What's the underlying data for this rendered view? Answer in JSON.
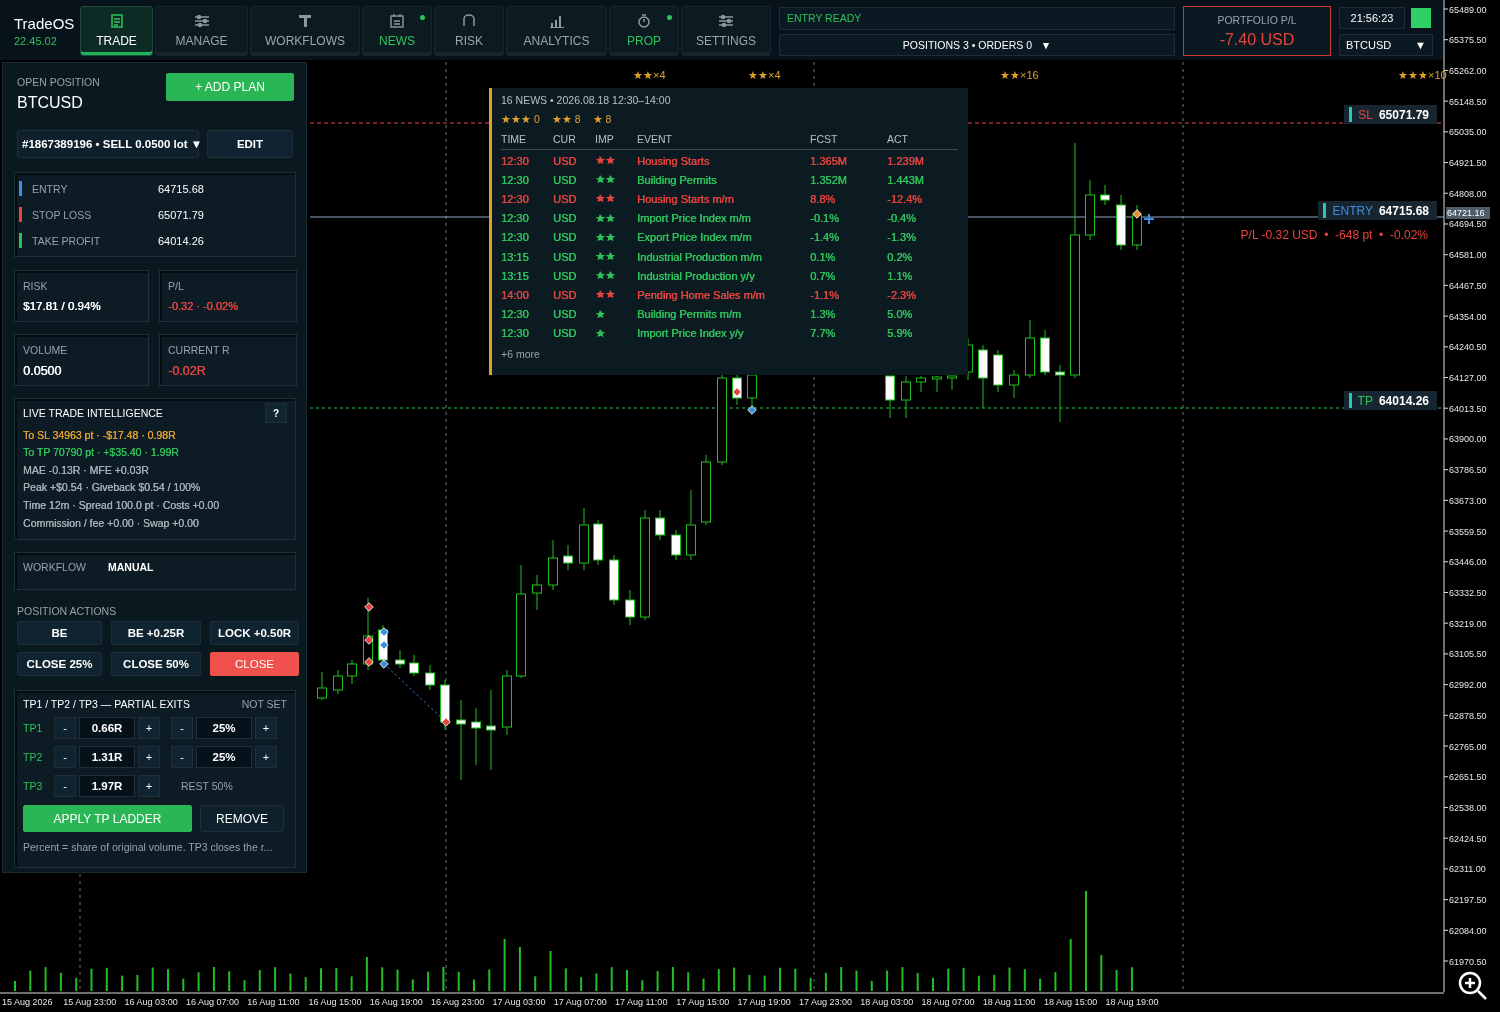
{
  "app": {
    "name": "TradeOS",
    "version": "22.45.02"
  },
  "tabs": [
    {
      "label": "TRADE",
      "selected": true,
      "alert": false
    },
    {
      "label": "MANAGE",
      "selected": false,
      "alert": false
    },
    {
      "label": "WORKFLOWS",
      "selected": false,
      "alert": false
    },
    {
      "label": "NEWS",
      "selected": false,
      "alert": true
    },
    {
      "label": "RISK",
      "selected": false,
      "alert": false
    },
    {
      "label": "ANALYTICS",
      "selected": false,
      "alert": false
    },
    {
      "label": "PROP",
      "selected": false,
      "alert": true
    },
    {
      "label": "SETTINGS",
      "selected": false,
      "alert": false
    }
  ],
  "status": {
    "message": "ENTRY READY",
    "summary": "POSITIONS 3 • ORDERS 0",
    "caret": "▼"
  },
  "portfolio": {
    "label": "PORTFOLIO P/L",
    "value": "-7.40 USD"
  },
  "clock": {
    "time": "21:56:23",
    "live": true,
    "symbol": "BTCUSD",
    "caret": "▼"
  },
  "position_panel": {
    "title": "OPEN POSITION",
    "symbol": "BTCUSD",
    "add_button": "+ ADD PLAN",
    "ticket": "#1867389196 • SELL 0.0500 lot ▼",
    "edit_button": "EDIT",
    "levels": [
      {
        "label": "ENTRY",
        "value": "64715.68",
        "color": "#3b8fe0"
      },
      {
        "label": "STOP LOSS",
        "value": "65071.79",
        "color": "#e5443f"
      },
      {
        "label": "TAKE PROFIT",
        "value": "64014.26",
        "color": "#2fc25b"
      }
    ],
    "metrics": [
      {
        "label": "RISK",
        "value": "$17.81 / 0.94%",
        "color": "#ffffff"
      },
      {
        "label": "P/L",
        "value": "-0.32 · -0.02%",
        "color": "#e5443f"
      },
      {
        "label": "VOLUME",
        "value": "0.0500",
        "color": "#ffffff"
      },
      {
        "label": "CURRENT R",
        "value": "-0.02R",
        "color": "#e5443f"
      }
    ],
    "intelligence": {
      "title": "LIVE TRADE INTELLIGENCE",
      "help": "?",
      "lines": [
        {
          "text": "To SL  34963 pt · -$17.48 · 0.98R",
          "color": "#e0a02c"
        },
        {
          "text": "To TP  70790 pt · +$35.40 · 1.99R",
          "color": "#2fc25b"
        },
        {
          "text": "MAE -0.13R · MFE +0.03R",
          "color": "#a3afb5"
        },
        {
          "text": "Peak +$0.54 · Giveback $0.54 / 100%",
          "color": "#a3afb5"
        },
        {
          "text": "Time 12m · Spread 100.0 pt · Costs +0.00",
          "color": "#a3afb5"
        },
        {
          "text": "Commission / fee +0.00 · Swap +0.00",
          "color": "#a3afb5"
        }
      ]
    },
    "workflow": {
      "label": "WORKFLOW",
      "value": "MANUAL"
    },
    "actions_title": "POSITION ACTIONS",
    "actions": [
      {
        "label": "BE",
        "kind": "normal"
      },
      {
        "label": "BE +0.25R",
        "kind": "normal"
      },
      {
        "label": "LOCK +0.50R",
        "kind": "normal"
      },
      {
        "label": "CLOSE 25%",
        "kind": "normal"
      },
      {
        "label": "CLOSE 50%",
        "kind": "normal"
      },
      {
        "label": "CLOSE",
        "kind": "danger"
      }
    ],
    "tp_ladder": {
      "title": "TP1 / TP2 / TP3 — PARTIAL EXITS",
      "state": "NOT SET",
      "rows": [
        {
          "label": "TP1",
          "minus": "-",
          "value": "0.66R",
          "plus": "+",
          "kind": "stepper",
          "p_minus": "-",
          "percent": "25%",
          "p_plus": "+"
        },
        {
          "label": "TP2",
          "minus": "-",
          "value": "1.31R",
          "plus": "+",
          "kind": "stepper",
          "p_minus": "-",
          "percent": "25%",
          "p_plus": "+"
        },
        {
          "label": "TP3",
          "minus": "-",
          "value": "1.97R",
          "plus": "+",
          "kind": "rest",
          "rest": "REST 50%"
        }
      ],
      "apply_button": "APPLY TP LADDER",
      "remove_button": "REMOVE",
      "note": "Percent = share of original volume. TP3 closes the r..."
    }
  },
  "chart": {
    "news_markers": [
      "★★×4",
      "★★×4",
      "★★×16",
      "★★★×10"
    ],
    "levels": [
      {
        "kind": "sl",
        "label": "SL",
        "value": "65071.79"
      },
      {
        "kind": "entry",
        "label": "ENTRY",
        "value": "64715.68"
      },
      {
        "kind": "tp",
        "label": "TP",
        "value": "64014.26"
      }
    ],
    "pl_line": "P/L -0.32 USD  •  -648 pt  •  -0.02%",
    "price_tag": "64721.16",
    "price_labels": [
      "65489.00",
      "65375.50",
      "65262.00",
      "65148.50",
      "65035.00",
      "64921.50",
      "64808.00",
      "64694.50",
      "64581.00",
      "64467.50",
      "64354.00",
      "64240.50",
      "64127.00",
      "64013.50",
      "63900.00",
      "63786.50",
      "63673.00",
      "63559.50",
      "63446.00",
      "63332.50",
      "63219.00",
      "63105.50",
      "62992.00",
      "62878.50",
      "62765.00",
      "62651.50",
      "62538.00",
      "62424.50",
      "62311.00",
      "62197.50",
      "62084.00",
      "61970.50"
    ],
    "time_labels": [
      "15 Aug 2026",
      "15 Aug 23:00",
      "16 Aug 03:00",
      "16 Aug 07:00",
      "16 Aug 11:00",
      "16 Aug 15:00",
      "16 Aug 19:00",
      "16 Aug 23:00",
      "17 Aug 03:00",
      "17 Aug 07:00",
      "17 Aug 11:00",
      "17 Aug 15:00",
      "17 Aug 19:00",
      "17 Aug 23:00",
      "18 Aug 03:00",
      "18 Aug 07:00",
      "18 Aug 11:00",
      "18 Aug 15:00",
      "18 Aug 19:00"
    ]
  },
  "news_popup": {
    "header": "16 NEWS • 2026.08.18 12:30–14:00",
    "counts": [
      "★★★ 0",
      "★★ 8",
      "★ 8"
    ],
    "columns": [
      "TIME",
      "CUR",
      "IMP",
      "EVENT",
      "FCST",
      "ACT"
    ],
    "rows": [
      {
        "time": "12:30",
        "cur": "USD",
        "imp": "★★",
        "event": "Housing Starts",
        "fcst": "1.365M",
        "act": "1.239M",
        "color": "#e5443f"
      },
      {
        "time": "12:30",
        "cur": "USD",
        "imp": "★★",
        "event": "Building Permits",
        "fcst": "1.352M",
        "act": "1.443M",
        "color": "#2fc25b"
      },
      {
        "time": "12:30",
        "cur": "USD",
        "imp": "★★",
        "event": "Housing Starts m/m",
        "fcst": "8.8%",
        "act": "-12.4%",
        "color": "#e5443f"
      },
      {
        "time": "12:30",
        "cur": "USD",
        "imp": "★★",
        "event": "Import Price Index m/m",
        "fcst": "-0.1%",
        "act": "-0.4%",
        "color": "#2fc25b"
      },
      {
        "time": "12:30",
        "cur": "USD",
        "imp": "★★",
        "event": "Export Price Index m/m",
        "fcst": "-1.4%",
        "act": "-1.3%",
        "color": "#2fc25b"
      },
      {
        "time": "13:15",
        "cur": "USD",
        "imp": "★★",
        "event": "Industrial Production m/m",
        "fcst": "0.1%",
        "act": "0.2%",
        "color": "#2fc25b"
      },
      {
        "time": "13:15",
        "cur": "USD",
        "imp": "★★",
        "event": "Industrial Production y/y",
        "fcst": "0.7%",
        "act": "1.1%",
        "color": "#2fc25b"
      },
      {
        "time": "14:00",
        "cur": "USD",
        "imp": "★★",
        "event": "Pending Home Sales m/m",
        "fcst": "-1.1%",
        "act": "-2.3%",
        "color": "#e5443f"
      },
      {
        "time": "12:30",
        "cur": "USD",
        "imp": "★",
        "event": "Building Permits m/m",
        "fcst": "1.3%",
        "act": "5.0%",
        "color": "#2fc25b"
      },
      {
        "time": "12:30",
        "cur": "USD",
        "imp": "★",
        "event": "Import Price Index y/y",
        "fcst": "7.7%",
        "act": "5.9%",
        "color": "#2fc25b"
      }
    ],
    "more": "+6 more"
  }
}
